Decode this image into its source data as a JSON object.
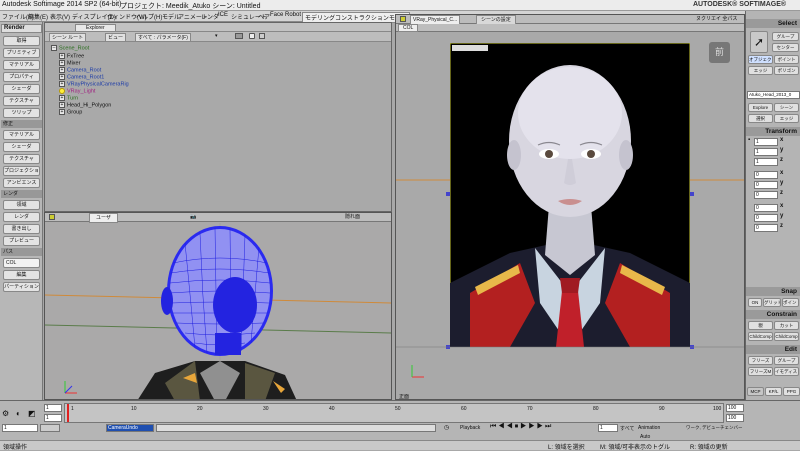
{
  "title_bar": {
    "app_title": "Autodesk Softimage 2014 SP2 (64-bit)",
    "project_label": "プロジェクト: Meedik_Atuko  シーン: Untitled",
    "brand": "AUTODESK® SOFTIMAGE®"
  },
  "menu": [
    "ファイル(F)",
    "編集(E)",
    "表示(V)",
    "ディスプレイ(D)",
    "ウィンドウ(W)",
    "ヘルプ(H)",
    "モデル",
    "アニメート",
    "レンダ",
    "ICE",
    "シミュレート",
    "ヘア",
    "Face Robot",
    "モデリングコンストラクションモード"
  ],
  "left_panel": {
    "header": "Render",
    "sections": [
      {
        "title": "",
        "buttons": [
          "取得",
          "プリミティブ",
          "マテリアル",
          "プロパティ",
          "シェーダ",
          "テクスチャ",
          "ツリップ"
        ]
      },
      {
        "title": "修正",
        "buttons": [
          "マテリアル",
          "シェーダ",
          "テクスチャ",
          "プロジェクション",
          "アンビエンス"
        ]
      },
      {
        "title": "レンダ",
        "buttons": [
          "領域",
          "レンダ",
          "書き出し",
          "プレビュー"
        ]
      },
      {
        "title": "パス",
        "buttons": [
          "COL",
          "編集",
          "パーティション"
        ]
      }
    ]
  },
  "explorer": {
    "toolbar": [
      "Explorer"
    ],
    "toolbar2": [
      "シーン ルート",
      "ビュー",
      "すべて : パラメータ(F)",
      "▾"
    ],
    "tree": [
      {
        "label": "Scene_Root",
        "color": "#2a6e1e",
        "indent": 0
      },
      {
        "label": "FxTree",
        "color": "#111111",
        "indent": 1
      },
      {
        "label": "Mixer",
        "color": "#111111",
        "indent": 1
      },
      {
        "label": "Camera_Root",
        "color": "#1c3ba8",
        "indent": 1
      },
      {
        "label": "Camera_Root1",
        "color": "#1c3ba8",
        "indent": 1
      },
      {
        "label": "VRayPhysicalCameraRig",
        "color": "#1c3ba8",
        "indent": 1
      },
      {
        "label": "VRay_Light",
        "color": "#a02080",
        "indent": 1
      },
      {
        "label": "Turn",
        "color": "#2a6e1e",
        "indent": 1
      },
      {
        "label": "Head_Hi_Polygon",
        "color": "#111111",
        "indent": 1
      },
      {
        "label": "Group",
        "color": "#111111",
        "indent": 1
      }
    ]
  },
  "left_viewport": {
    "view": "ユーザ",
    "shading": "Wireframe",
    "mode": "隠れ面"
  },
  "right_viewport": {
    "camera": "COL",
    "view": "VRay_Physical_C...",
    "render_label": "シーンの設定",
    "footer": "正面",
    "overlay_badge": "前",
    "status_text": "ヌクリエイ 全パス"
  },
  "right_panel": {
    "select_header": "Select",
    "select_buttons": [
      "グループ",
      "センター",
      "オブジェクト",
      "ポイント",
      "エッジ",
      "ポリゴン"
    ],
    "object_name": "Atuko_Head_2013_0",
    "explore_buttons": [
      "Explore",
      "シーン",
      "選択",
      "エッジ"
    ],
    "transform_header": "Transform",
    "transform": {
      "s": [
        "1",
        "1",
        "1"
      ],
      "r": [
        "0",
        "0",
        "0"
      ],
      "t": [
        "0",
        "0",
        "0"
      ]
    },
    "snap_header": "Snap",
    "snap_buttons": [
      "ON",
      "グリッド",
      "ポイント"
    ],
    "constrain_header": "Constrain",
    "constrain_buttons": [
      "親",
      "カット",
      "ChildComp",
      "ChildComp"
    ],
    "edit_header": "Edit",
    "edit_buttons": [
      "フリーズ",
      "グループ",
      "フリーズM",
      "イモディスト"
    ],
    "tabs": [
      "MCP",
      "KP/L",
      "PPG"
    ]
  },
  "timeline": {
    "start": "1",
    "current": "1",
    "end": "100",
    "ticks": [
      "1",
      "10",
      "20",
      "30",
      "40",
      "50",
      "60",
      "70",
      "80",
      "90",
      "100"
    ],
    "range_end": "100",
    "playback_label": "Playback",
    "animation_label": "Animation",
    "auto_label": "Auto",
    "camera_field": "CameraUndo",
    "options": [
      "すべて",
      "ワーク, デビューチェンバー"
    ]
  },
  "status_bar": {
    "left": "領域操作",
    "mid1": "L: 領域を選択",
    "mid2": "M: 領域/可非表示のトグル",
    "right": "R: 領域の更新"
  }
}
